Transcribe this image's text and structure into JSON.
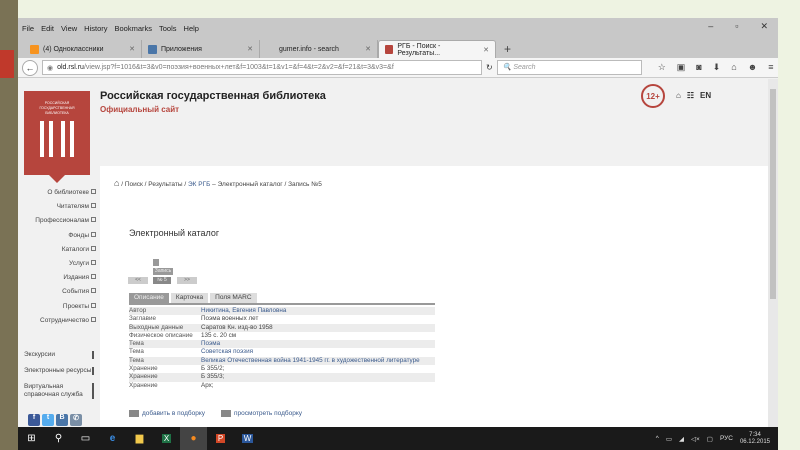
{
  "browser": {
    "menu": [
      "File",
      "Edit",
      "View",
      "History",
      "Bookmarks",
      "Tools",
      "Help"
    ],
    "tabs": [
      {
        "label": "(4) Одноклассники",
        "favicon_color": "#f7931e",
        "active": false
      },
      {
        "label": "Приложения",
        "favicon_color": "#4a76a8",
        "active": false
      },
      {
        "label": "gumer.info - search",
        "favicon_color": "",
        "active": false
      },
      {
        "label": "РГБ - Поиск - Результаты...",
        "favicon_color": "#b6453d",
        "active": true
      }
    ],
    "url_host": "old.rsl.ru",
    "url_path": "/view.jsp?f=1016&t=3&v0=поэзия+военных+лет&f=1003&t=1&v1=&f=4&t=2&v2=&f=21&t=3&v3=&f",
    "search_placeholder": "Search"
  },
  "site": {
    "logo_text": "РОССИЙСКАЯ ГОСУДАРСТВЕННАЯ БИБЛИОТЕКА",
    "title": "Российская государственная библиотека",
    "subtitle": "Официальный сайт",
    "age": "12+",
    "lang": "EN",
    "accent": "#b6453d"
  },
  "sidebar": {
    "items": [
      "О библиотеке",
      "Читателям",
      "Профессионалам",
      "Фонды",
      "Каталоги",
      "Услуги",
      "Издания",
      "События",
      "Проекты",
      "Сотрудничество"
    ],
    "extra": [
      "Экскурсии",
      "Электронные ресурсы",
      "Виртуальная справочная служба"
    ],
    "social": [
      "f",
      "t",
      "B",
      "✆"
    ]
  },
  "breadcrumb": {
    "items": [
      "Поиск",
      "Результаты"
    ],
    "link": "ЭК РГБ",
    "rest": "– Электронный каталог / Запись №5"
  },
  "catalog": {
    "title": "Электронный каталог",
    "record_label": "Запись",
    "record_no": "№ 5",
    "prev": "<<",
    "next": ">>",
    "tabs": [
      "Описание",
      "Карточка",
      "Поля MARC"
    ],
    "rows": [
      {
        "k": "Автор",
        "v": "Никитина, Евгения Павловна",
        "link": true
      },
      {
        "k": "Заглавие",
        "v": "Поэма военных лет",
        "link": false
      },
      {
        "k": "Выходные данные",
        "v": "Саратов Кн. изд-во 1958",
        "link": false
      },
      {
        "k": "Физическое описание",
        "v": "135 с. 20 см",
        "link": false
      },
      {
        "k": "Тема",
        "v": "Поэма",
        "link": true
      },
      {
        "k": "Тема",
        "v": "Советская поэзия",
        "link": true
      },
      {
        "k": "Тема",
        "v": "Великая Отечественная война 1941-1945 гг. в художественной литературе",
        "link": true
      },
      {
        "k": "Хранение",
        "v": "Б 355/2;",
        "link": false
      },
      {
        "k": "Хранение",
        "v": "Б 355/3;",
        "link": false
      },
      {
        "k": "Хранение",
        "v": "Арх;",
        "link": false
      }
    ],
    "add": "добавить в подборку",
    "view": "просмотреть подборку"
  },
  "taskbar": {
    "lang": "РУС",
    "time": "7:34",
    "date": "06.12.2015"
  }
}
